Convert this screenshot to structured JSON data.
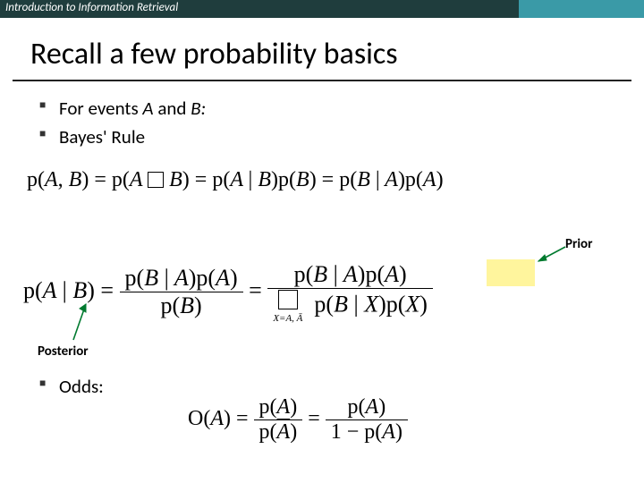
{
  "header": {
    "course": "Introduction to Information Retrieval"
  },
  "title": "Recall a few probability basics",
  "bullets": {
    "item1_pre": "For events ",
    "item1_A": "A",
    "item1_mid": " and ",
    "item1_B": "B:",
    "item2": "Bayes' Rule",
    "item3": "Odds:"
  },
  "labels": {
    "prior": "Prior",
    "posterior": "Posterior"
  },
  "equations": {
    "joint": "p(A, B) = p(A □ B) = p(A | B)p(B) = p(B | A)p(A)",
    "bayes_lhs": "p(A | B)",
    "bayes_mid_num": "p(B | A)p(A)",
    "bayes_mid_den": "p(B)",
    "bayes_rhs_num": "p(B | A)p(A)",
    "bayes_rhs_den_sum": "p(B | X)p(X)",
    "bayes_sum_limit": "X=A, Ā",
    "odds_lhs": "O(A)",
    "odds_mid_num": "p(A)",
    "odds_mid_den": "p(Ā)",
    "odds_rhs_num": "p(A)",
    "odds_rhs_den": "1 − p(A)"
  }
}
